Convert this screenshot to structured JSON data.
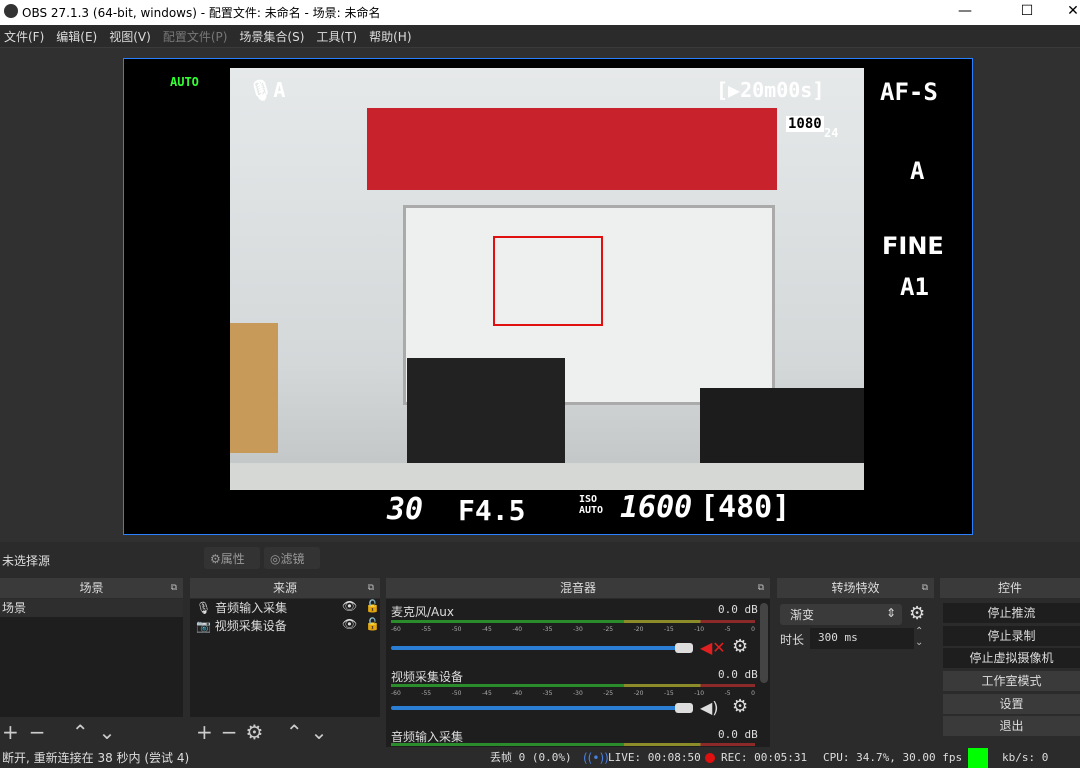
{
  "window": {
    "title": "OBS 27.1.3 (64-bit, windows) - 配置文件: 未命名 - 场景: 未命名",
    "minimize": "—",
    "maximize": "☐",
    "close": "✕"
  },
  "menu": [
    {
      "label": "文件(F)"
    },
    {
      "label": "编辑(E)"
    },
    {
      "label": "视图(V)"
    },
    {
      "label": "配置文件(P)",
      "disabled": true
    },
    {
      "label": "场景集合(S)"
    },
    {
      "label": "工具(T)"
    },
    {
      "label": "帮助(H)"
    }
  ],
  "camera_overlay": {
    "auto": "AUTO",
    "mic": "🎙A",
    "rec_time": "[▶20m00s]",
    "af": "AF-S",
    "res": "1080",
    "fps": "24",
    "scene_a": "A",
    "quality": "FINE",
    "wb": "A1",
    "shutter": "30",
    "aperture": "F4.5",
    "iso_label": "ISO AUTO",
    "iso": "1600",
    "shots": "[480]"
  },
  "source_toolbar": {
    "no_source": "未选择源",
    "properties": "属性",
    "filters": "滤镜"
  },
  "scenes": {
    "title": "场景",
    "items": [
      "场景"
    ]
  },
  "sources": {
    "title": "来源",
    "items": [
      {
        "name": "音频输入采集",
        "icon": "microphone-icon"
      },
      {
        "name": "视频采集设备",
        "icon": "camera-icon"
      }
    ]
  },
  "mixer": {
    "title": "混音器",
    "ticks": [
      "-60",
      "-55",
      "-50",
      "-45",
      "-40",
      "-35",
      "-30",
      "-25",
      "-20",
      "-15",
      "-10",
      "-5",
      "0"
    ],
    "channels": [
      {
        "name": "麦克风/Aux",
        "db": "0.0 dB",
        "muted": true
      },
      {
        "name": "视频采集设备",
        "db": "0.0 dB",
        "muted": false
      },
      {
        "name": "音频输入采集",
        "db": "0.0 dB"
      }
    ]
  },
  "transitions": {
    "title": "转场特效",
    "selected": "渐变",
    "duration_label": "时长",
    "duration": "300 ms"
  },
  "controls": {
    "title": "控件",
    "buttons": [
      "停止推流",
      "停止录制",
      "停止虚拟摄像机",
      "工作室模式",
      "设置",
      "退出"
    ]
  },
  "status": {
    "message": "断开, 重新连接在 38 秒内 (尝试 4)",
    "dropped": "丢帧 0 (0.0%)",
    "live": "LIVE: 00:08:50",
    "rec": "REC: 00:05:31",
    "cpu": "CPU: 34.7%, 30.00 fps",
    "kbs": "kb/s: 0",
    "indicator_color": "#00ff00"
  }
}
